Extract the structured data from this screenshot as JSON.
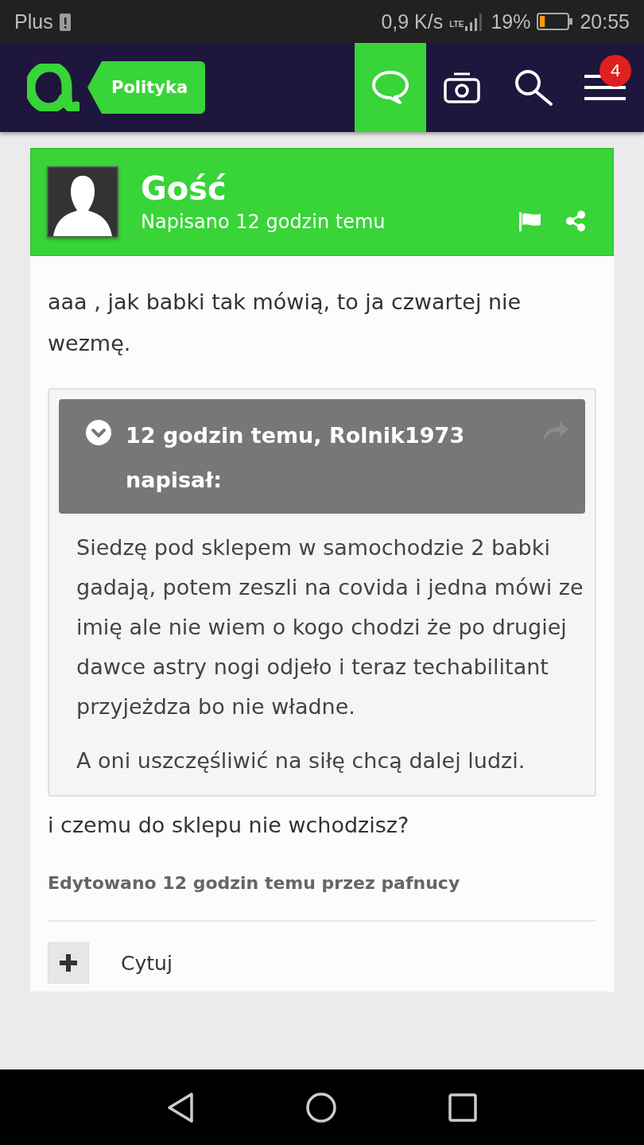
{
  "status_bar": {
    "carrier": "Plus",
    "speed": "0,9 K/s",
    "network": "LTE",
    "battery_text": "19%",
    "battery": {
      "level": 0.19
    },
    "time": "20:55"
  },
  "nav": {
    "category": "Polityka",
    "buttons": [
      {
        "kind": "chat",
        "selected": true
      },
      {
        "kind": "camera",
        "selected": false
      },
      {
        "kind": "search",
        "selected": false
      },
      {
        "kind": "menu",
        "selected": false,
        "badge": "4"
      }
    ]
  },
  "post": {
    "author": "Gość",
    "posted": "Napisano 12 godzin temu",
    "intro": "aaa , jak babki tak mówią, to ja czwartej nie wezmę.",
    "quote": {
      "header": "12 godzin temu, Rolnik1973 napisał:",
      "paragraphs": [
        "Siedzę pod sklepem w samochodzie 2 babki gadają, potem zeszli na covida i jedna mówi ze  imię ale nie wiem o kogo chodzi że po drugiej dawce astry nogi odjeło i teraz techabilitant przyjeżdza bo nie władne.",
        "A oni uszczęśliwić na siłę chcą dalej ludzi."
      ]
    },
    "reply": "i czemu do sklepu nie wchodzisz?",
    "edited": "Edytowano 12 godzin temu przez pafnucy",
    "actions": [
      {
        "label": "Cytuj"
      }
    ]
  }
}
